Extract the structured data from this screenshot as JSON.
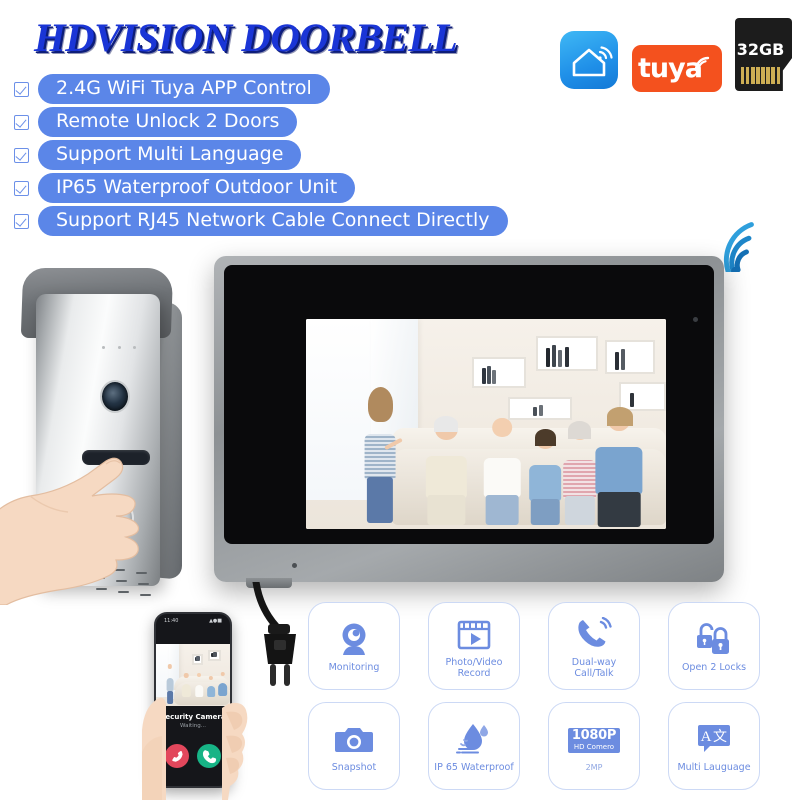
{
  "header": {
    "title": "HDVISION DOORBELL",
    "title_color": "#1A35D6",
    "accent_color": "#5b86e8"
  },
  "features_list": [
    {
      "checkbox_icon": "checkbox-checked-icon",
      "text": "2.4G WiFi Tuya APP Control"
    },
    {
      "checkbox_icon": "checkbox-checked-icon",
      "text": "Remote Unlock 2 Doors"
    },
    {
      "checkbox_icon": "checkbox-checked-icon",
      "text": "Support Multi Language"
    },
    {
      "checkbox_icon": "checkbox-checked-icon",
      "text": "IP65 Waterproof Outdoor Unit"
    },
    {
      "checkbox_icon": "checkbox-checked-icon",
      "text": "Support RJ45 Network Cable Connect Directly"
    }
  ],
  "badges": {
    "smart_life": {
      "icon": "smart-home-wifi-icon",
      "color": "#1f8fe8"
    },
    "tuya": {
      "label": "tuya",
      "icon": "wifi-arc-icon",
      "color": "#f4511e"
    },
    "sd_card": {
      "capacity": "32GB",
      "icon": "microsd-card-icon",
      "color": "#1c1c1c"
    }
  },
  "wifi_signal": {
    "icon": "wifi-signal-icon",
    "color": "#1e8bd4"
  },
  "outdoor_unit": {
    "name": "outdoor-door-station",
    "lens_icon": "camera-lens-icon",
    "button_icon": "call-button-icon",
    "grille_icon": "speaker-grille-icon",
    "hand_icon": "hand-pressing-icon"
  },
  "indoor_monitor": {
    "name": "indoor-monitor",
    "mic_icon": "microphone-icon",
    "plug_icon": "power-plug-icon",
    "screen_scene": "family-living-room"
  },
  "phone": {
    "status_time": "11:40",
    "status_icons": "signal-wifi-battery",
    "caller_title": "Security Camera",
    "caller_status": "Waiting...",
    "decline_icon": "call-decline-icon",
    "accept_icon": "call-accept-icon",
    "decline_color": "#e2475c",
    "accept_color": "#17b486"
  },
  "feature_cards": [
    {
      "icon": "monitoring-camera-icon",
      "label": "Monitoring",
      "sub": ""
    },
    {
      "icon": "video-record-icon",
      "label": "Photo/Video Record",
      "sub": ""
    },
    {
      "icon": "phone-call-icon",
      "label": "Dual-way Call/Talk",
      "sub": ""
    },
    {
      "icon": "two-padlocks-icon",
      "label": "Open 2 Locks",
      "sub": ""
    },
    {
      "icon": "camera-snapshot-icon",
      "label": "Snapshot",
      "sub": ""
    },
    {
      "icon": "water-drop-icon",
      "label": "IP 65 Waterproof",
      "sub": ""
    },
    {
      "icon": "resolution-badge-icon",
      "label": "",
      "sub": "2MP",
      "badge_big": "1080P",
      "badge_small": "HD Comero"
    },
    {
      "icon": "translate-icon",
      "label": "Multi Lauguage",
      "sub": ""
    }
  ]
}
